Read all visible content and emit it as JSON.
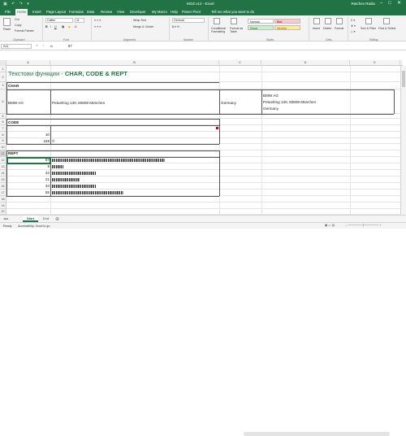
{
  "titlebar": {
    "title": "MOZ.v12 - Excel",
    "user": "Ratchev Radio",
    "minimize": "–",
    "maximize": "□",
    "close": "✕"
  },
  "tabs": [
    "File",
    "Home",
    "Insert",
    "Page Layout",
    "Formulas",
    "Data",
    "Review",
    "View",
    "Developer",
    "My Macro",
    "Help",
    "Power Pivot",
    "Tell me what you want to do"
  ],
  "ribbon": {
    "paste": "Paste",
    "cut": "Cut",
    "copy": "Copy",
    "format_painter": "Format Painter",
    "clipboard": "Clipboard",
    "font_name": "Calibri",
    "font_size": "11",
    "font_group": "Font",
    "wrap_text": "Wrap Text",
    "merge_center": "Merge & Center",
    "alignment": "Alignment",
    "number_format": "General",
    "number": "Number",
    "conditional_formatting": "Conditional Formatting",
    "format_as_table": "Format as Table",
    "style_normal": "Normal",
    "style_bad": "Bad",
    "style_good": "Good",
    "style_neutral": "Neutral",
    "styles": "Styles",
    "insert": "Insert",
    "delete": "Delete",
    "format": "Format",
    "cells": "Cells",
    "sort_filter": "Sort & Filter",
    "find_select": "Find & Select",
    "editing": "Editing"
  },
  "formula_bar": {
    "name_box": "A11",
    "fx": "fx",
    "value": "87"
  },
  "columns": [
    "A",
    "B",
    "C",
    "D",
    "E"
  ],
  "rows": [
    "1",
    "2",
    "3",
    "4",
    "5",
    "6",
    "7",
    "8",
    "9",
    "10",
    "11",
    "12",
    "13",
    "14",
    "15",
    "16",
    "17",
    "18",
    "19",
    "20"
  ],
  "sheet": {
    "title_prefix": "Текстови функции - ",
    "title_bold": "CHAR, CODE & REPT",
    "char_header": "CHAR",
    "char_a": "BMW AG",
    "char_b": "Petuelring 130, 80809 München",
    "char_c": "Germany",
    "char_d1": "BMW AG",
    "char_d2": "Petuelring 130, 80809 München",
    "char_d3": "Germany",
    "code_header": "CODE",
    "code_v1": "10",
    "code_v2": "169",
    "code_b2": "©",
    "rept_header": "REPT",
    "rept_values": [
      "87",
      "9",
      "34",
      "21",
      "34",
      "55"
    ],
    "rept_bars": [
      87,
      9,
      34,
      21,
      34,
      55
    ]
  },
  "sheets": [
    "Start",
    "End"
  ],
  "status": {
    "ready": "Ready",
    "accessibility": "Accessibility: Good to go"
  },
  "colors": {
    "accent": "#217346",
    "title_green": "#217346"
  }
}
